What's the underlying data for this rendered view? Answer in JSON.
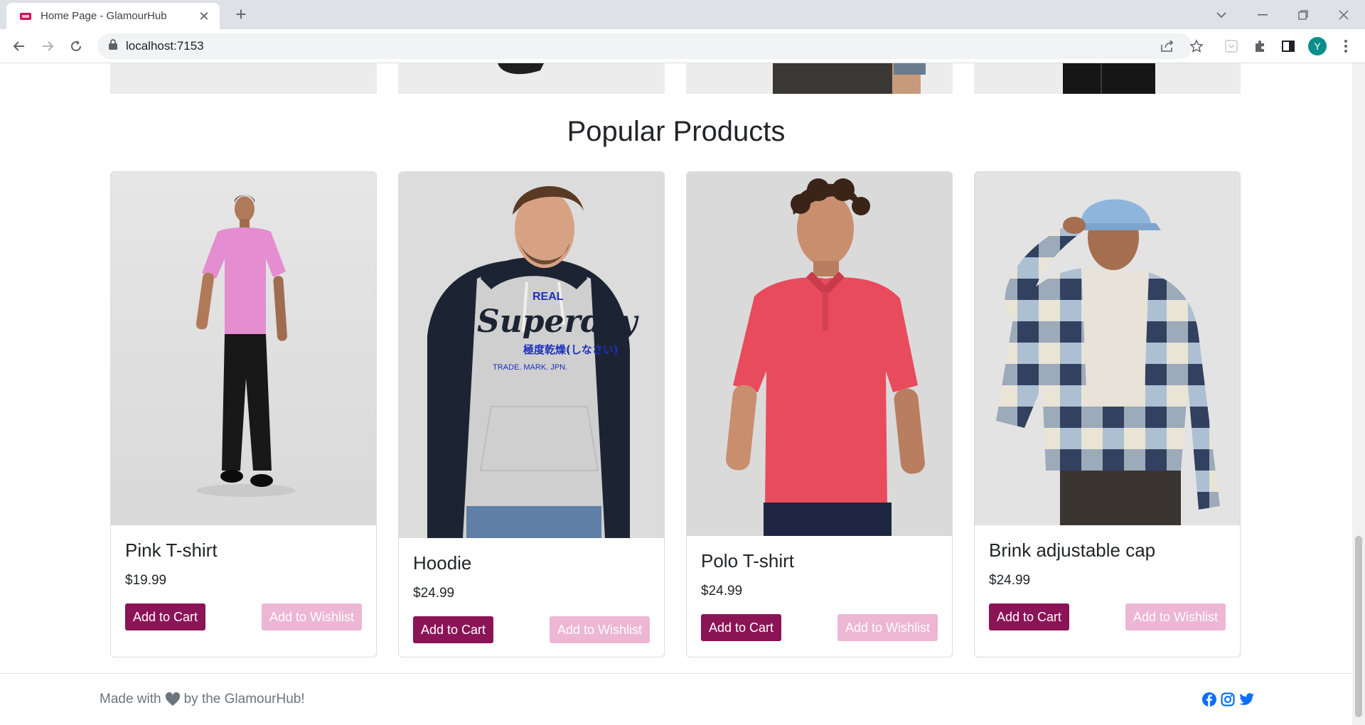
{
  "browser": {
    "tab_title": "Home Page - GlamourHub",
    "url": "localhost:7153",
    "profile_initial": "Y"
  },
  "page": {
    "section_title": "Popular Products",
    "products": [
      {
        "name": "Pink T-shirt",
        "price": "$19.99",
        "cart_label": "Add to Cart",
        "wishlist_label": "Add to Wishlist",
        "image": "man-pink-tshirt-photo"
      },
      {
        "name": "Hoodie",
        "price": "$24.99",
        "cart_label": "Add to Cart",
        "wishlist_label": "Add to Wishlist",
        "image": "man-grey-navy-hoodie-photo",
        "hoodie_print": {
          "line1": "REAL",
          "line2": "Superdry",
          "line3": "極度乾燥(しなさい)",
          "line4": "TRADE. MARK. JPN."
        }
      },
      {
        "name": "Polo T-shirt",
        "price": "$24.99",
        "cart_label": "Add to Cart",
        "wishlist_label": "Add to Wishlist",
        "image": "man-red-polo-photo"
      },
      {
        "name": "Brink adjustable cap",
        "price": "$24.99",
        "cart_label": "Add to Cart",
        "wishlist_label": "Add to Wishlist",
        "image": "man-checked-shirt-cap-photo"
      }
    ],
    "footer": {
      "made_with": "Made with",
      "by_text": "by the GlamourHub!",
      "social": [
        "facebook-icon",
        "instagram-icon",
        "twitter-icon"
      ]
    }
  },
  "colors": {
    "primary": "#8b1457",
    "wishlist": "#edb6d4",
    "social_blue": "#0d6efd"
  }
}
